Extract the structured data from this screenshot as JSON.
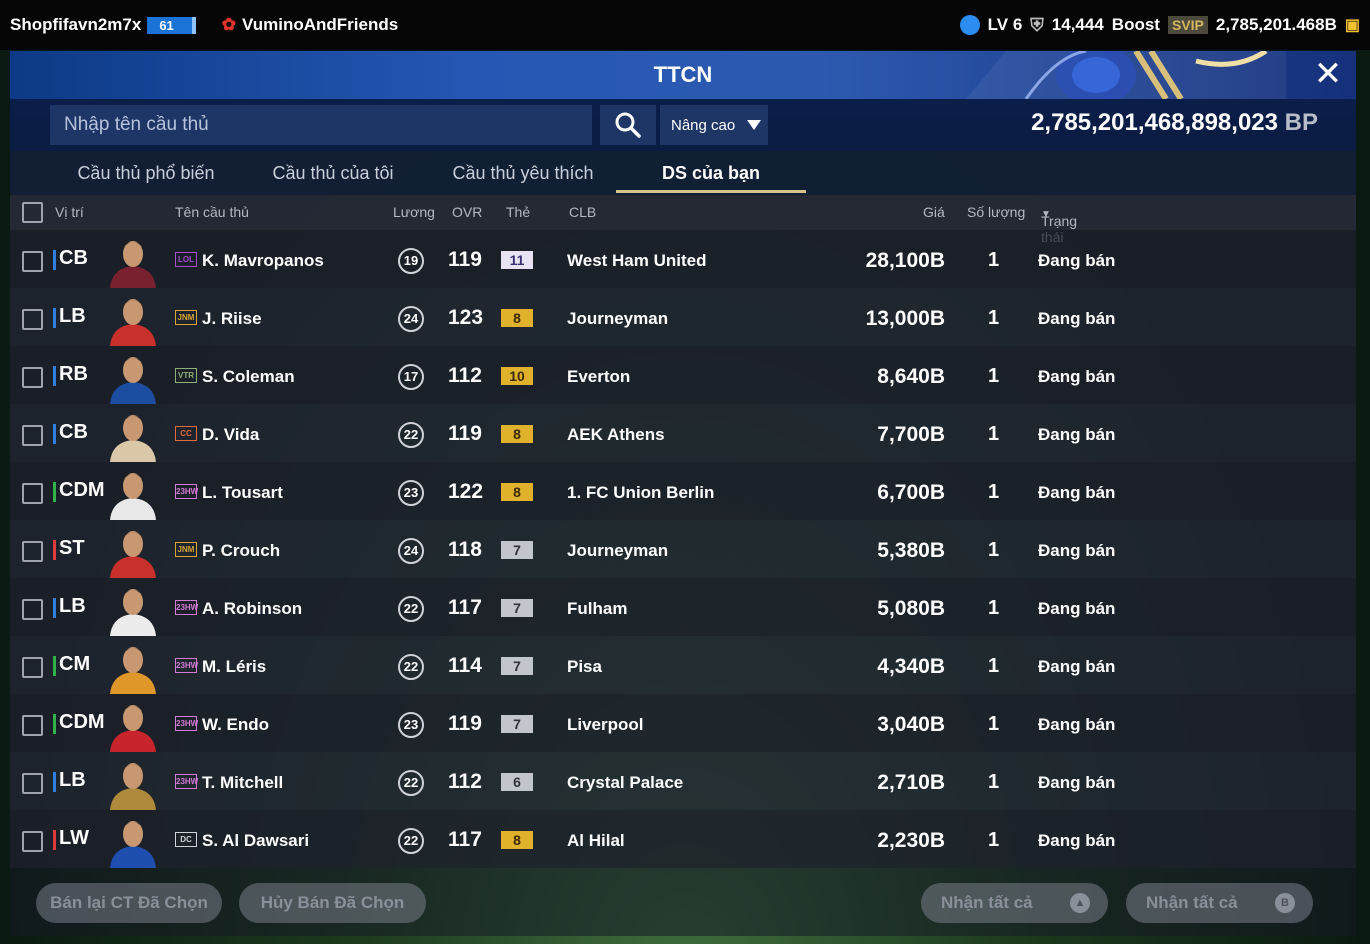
{
  "topbar": {
    "username": "Shopfifavn2m7x",
    "level_badge": "61",
    "club_name": "VuminoAndFriends",
    "lv": "LV 6",
    "trophy_count": "14,444",
    "boost_label": "Boost",
    "svip_label": "SVIP",
    "coins": "2,785,201.468B"
  },
  "window": {
    "title": "TTCN"
  },
  "search": {
    "placeholder": "Nhập tên cầu thủ",
    "advanced_label": "Nâng cao",
    "bp_value": "2,785,201,468,898,023",
    "bp_unit": "BP"
  },
  "tabs": [
    {
      "label": "Cầu thủ phổ biến"
    },
    {
      "label": "Cầu thủ của tôi"
    },
    {
      "label": "Cầu thủ yêu thích"
    },
    {
      "label": "DS của bạn",
      "active": true
    }
  ],
  "columns": {
    "position": "Vị trí",
    "name": "Tên cầu thủ",
    "salary": "Lương",
    "ovr": "OVR",
    "card": "Thẻ",
    "club": "CLB",
    "price": "Giá",
    "quantity": "Số lượng",
    "status": "Trạng thái"
  },
  "players": [
    {
      "pos": "CB",
      "pos_color": "#2f7fe0",
      "season": "LOL",
      "season_color": "#a74bd0",
      "name": "K. Mavropanos",
      "salary": "19",
      "ovr": "119",
      "grade": "11",
      "grade_bg": "#e8e2f2",
      "grade_color": "#3b2e72",
      "club": "West Ham United",
      "price": "28,100B",
      "qty": "1",
      "status": "Đang bán",
      "face_color": "#7a2130"
    },
    {
      "pos": "LB",
      "pos_color": "#2f7fe0",
      "season": "JNM",
      "season_color": "#d9a534",
      "name": "J. Riise",
      "salary": "24",
      "ovr": "123",
      "grade": "8",
      "grade_bg": "#e0b22c",
      "grade_color": "#3a2a00",
      "club": "Journeyman",
      "price": "13,000B",
      "qty": "1",
      "status": "Đang bán",
      "face_color": "#c8302c"
    },
    {
      "pos": "RB",
      "pos_color": "#2f7fe0",
      "season": "VTR",
      "season_color": "#8fb07a",
      "name": "S. Coleman",
      "salary": "17",
      "ovr": "112",
      "grade": "10",
      "grade_bg": "#e0b22c",
      "grade_color": "#3a2a00",
      "club": "Everton",
      "price": "8,640B",
      "qty": "1",
      "status": "Đang bán",
      "face_color": "#1d4da0"
    },
    {
      "pos": "CB",
      "pos_color": "#2f7fe0",
      "season": "CC",
      "season_color": "#e06a3a",
      "name": "D. Vida",
      "salary": "22",
      "ovr": "119",
      "grade": "8",
      "grade_bg": "#e0b22c",
      "grade_color": "#3a2a00",
      "club": "AEK Athens",
      "price": "7,700B",
      "qty": "1",
      "status": "Đang bán",
      "face_color": "#d9c7a8"
    },
    {
      "pos": "CDM",
      "pos_color": "#2fb24a",
      "season": "23HW",
      "season_color": "#d37ad6",
      "name": "L. Tousart",
      "salary": "23",
      "ovr": "122",
      "grade": "8",
      "grade_bg": "#e0b22c",
      "grade_color": "#3a2a00",
      "club": "1. FC Union Berlin",
      "price": "6,700B",
      "qty": "1",
      "status": "Đang bán",
      "face_color": "#e8e8e8"
    },
    {
      "pos": "ST",
      "pos_color": "#e03a3a",
      "season": "JNM",
      "season_color": "#d9a534",
      "name": "P. Crouch",
      "salary": "24",
      "ovr": "118",
      "grade": "7",
      "grade_bg": "#c2c6cc",
      "grade_color": "#30343a",
      "club": "Journeyman",
      "price": "5,380B",
      "qty": "1",
      "status": "Đang bán",
      "face_color": "#c8302c"
    },
    {
      "pos": "LB",
      "pos_color": "#2f7fe0",
      "season": "23HW",
      "season_color": "#d37ad6",
      "name": "A. Robinson",
      "salary": "22",
      "ovr": "117",
      "grade": "7",
      "grade_bg": "#c2c6cc",
      "grade_color": "#30343a",
      "club": "Fulham",
      "price": "5,080B",
      "qty": "1",
      "status": "Đang bán",
      "face_color": "#ececec"
    },
    {
      "pos": "CM",
      "pos_color": "#2fb24a",
      "season": "23HW",
      "season_color": "#d37ad6",
      "name": "M. Léris",
      "salary": "22",
      "ovr": "114",
      "grade": "7",
      "grade_bg": "#c2c6cc",
      "grade_color": "#30343a",
      "club": "Pisa",
      "price": "4,340B",
      "qty": "1",
      "status": "Đang bán",
      "face_color": "#e0972a"
    },
    {
      "pos": "CDM",
      "pos_color": "#2fb24a",
      "season": "23HW",
      "season_color": "#d37ad6",
      "name": "W. Endo",
      "salary": "23",
      "ovr": "119",
      "grade": "7",
      "grade_bg": "#c2c6cc",
      "grade_color": "#30343a",
      "club": "Liverpool",
      "price": "3,040B",
      "qty": "1",
      "status": "Đang bán",
      "face_color": "#c8242c"
    },
    {
      "pos": "LB",
      "pos_color": "#2f7fe0",
      "season": "23HW",
      "season_color": "#d37ad6",
      "name": "T. Mitchell",
      "salary": "22",
      "ovr": "112",
      "grade": "6",
      "grade_bg": "#c2c6cc",
      "grade_color": "#30343a",
      "club": "Crystal Palace",
      "price": "2,710B",
      "qty": "1",
      "status": "Đang bán",
      "face_color": "#b08a3c"
    },
    {
      "pos": "LW",
      "pos_color": "#e03a3a",
      "season": "DC",
      "season_color": "#cfd2d8",
      "name": "S. Al Dawsari",
      "salary": "22",
      "ovr": "117",
      "grade": "8",
      "grade_bg": "#e0b22c",
      "grade_color": "#3a2a00",
      "club": "Al Hilal",
      "price": "2,230B",
      "qty": "1",
      "status": "Đang bán",
      "face_color": "#1e4fb0"
    }
  ],
  "footer": {
    "resell_label": "Bán lại CT Đã Chọn",
    "cancel_label": "Hủy Bán Đã Chọn",
    "claim_all_1": "Nhận tất cả",
    "claim_all_2": "Nhận tất cả"
  }
}
